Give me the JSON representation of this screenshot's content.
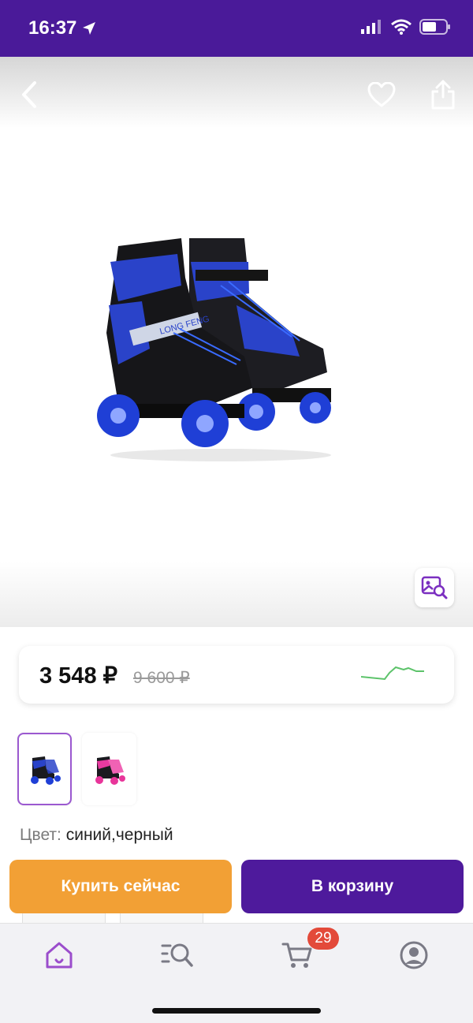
{
  "status_bar": {
    "time": "16:37",
    "icons": [
      "location-arrow-icon",
      "signal-icon",
      "wifi-icon",
      "battery-icon"
    ]
  },
  "header": {
    "icons": [
      "back-chevron-icon",
      "heart-icon",
      "share-icon"
    ]
  },
  "product": {
    "image": "blue-black-quad-roller-skates",
    "brand_text": "LONG FENG",
    "visual_search_icon": "image-search-icon"
  },
  "price": {
    "current": "3 548 ₽",
    "old": "9 600 ₽",
    "trend_color": "#5cc36a"
  },
  "variants": [
    {
      "name": "blue-black",
      "selected": true
    },
    {
      "name": "pink-black",
      "selected": false
    }
  ],
  "color": {
    "label": "Цвет:",
    "value": "синий,черный"
  },
  "actions": {
    "buy_now": "Купить сейчас",
    "add_to_cart": "В корзину",
    "buy_color": "#f2a035",
    "cart_color": "#4e1a9c"
  },
  "tabbar": {
    "items": [
      "home-icon",
      "catalog-search-icon",
      "cart-icon",
      "profile-icon"
    ],
    "cart_badge": "29",
    "active_color": "#9b4dcc"
  }
}
